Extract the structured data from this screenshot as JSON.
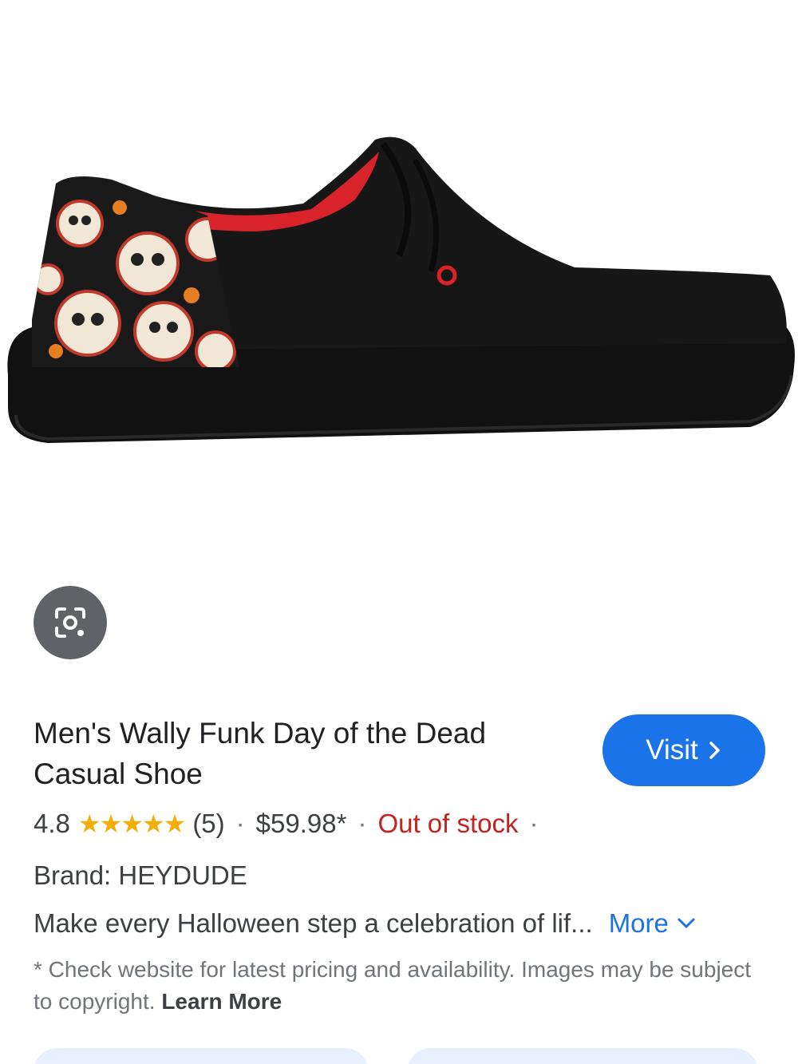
{
  "product": {
    "title": "Men's Wally Funk Day of the Dead Casual Shoe",
    "image_icon": "shoe-product-photo",
    "rating": "4.8",
    "stars": "★★★★★",
    "review_count": "(5)",
    "price": "$59.98*",
    "stock_status": "Out of stock",
    "separator": "·",
    "brand": "Brand: HEYDUDE",
    "description": "Make every Halloween step a celebration of lif...",
    "more_label": "More"
  },
  "actions": {
    "visit_label": "Visit",
    "lens_icon": "camera-lens-icon"
  },
  "disclaimer": {
    "text": "* Check website for latest pricing and availability. Images may be subject to copyright.",
    "learn_more": "Learn More"
  },
  "colors": {
    "accent": "#1a73e8",
    "out_of_stock": "#c5221f",
    "star": "#f6ad08",
    "lens_bg": "#5f6368"
  }
}
